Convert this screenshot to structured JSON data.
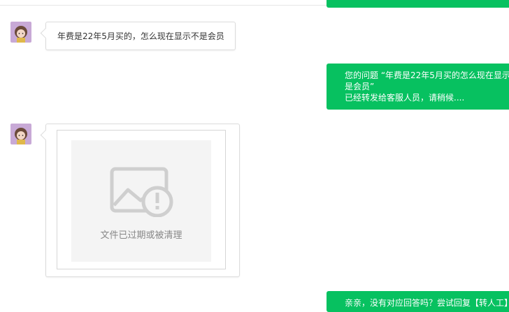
{
  "messages": {
    "user_question": "年费是22年5月买的，怎么现在显示不是会员",
    "reply_forwarded": {
      "line1": "您的问题 “年费是22年5月买的怎么现在显示",
      "line2": "是会员”",
      "line3": "已经转发给客服人员，请稍候...."
    },
    "expired_file": {
      "icon": "broken-image-icon",
      "label": "文件已过期或被清理"
    },
    "reply_no_answer": "亲亲，没有对应回答吗？尝试回复【转人工】"
  },
  "colors": {
    "accent_green": "#07c160",
    "bubble_border": "#dcdcdc",
    "file_bg": "#f4f4f4"
  }
}
